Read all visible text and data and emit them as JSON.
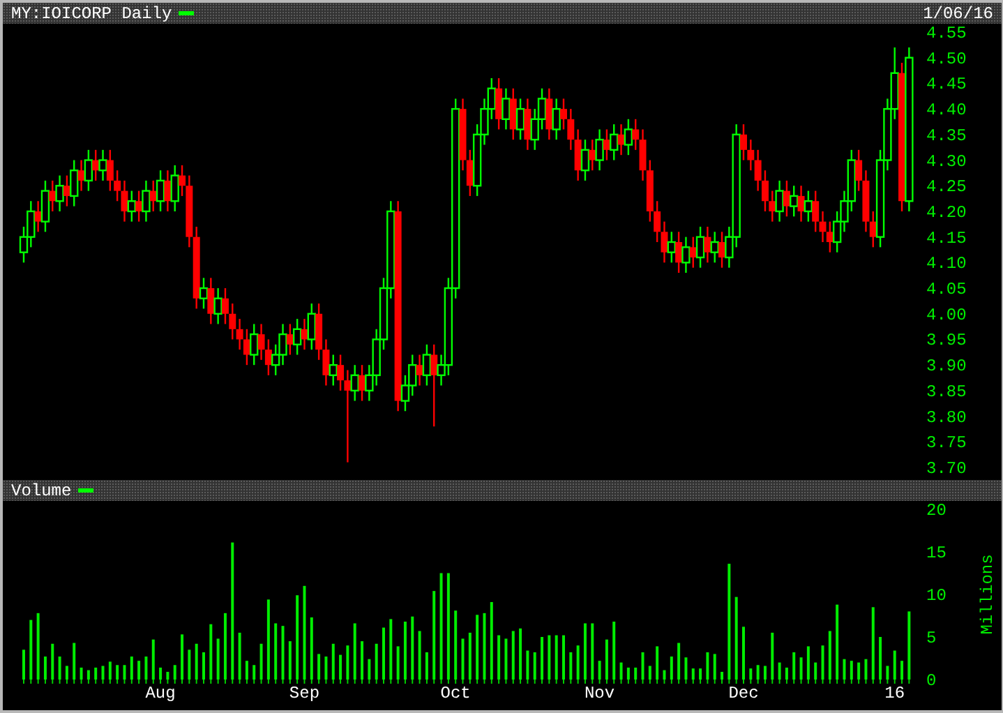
{
  "header": {
    "title": "MY:IOICORP Daily",
    "date": "1/06/16"
  },
  "price_panel": {
    "chart_data": {
      "type": "candlestick",
      "ylim": [
        3.7,
        4.55
      ],
      "yticks": [
        {
          "value": 4.55,
          "label": "4.55"
        },
        {
          "value": 4.5,
          "label": "4.50"
        },
        {
          "value": 4.45,
          "label": "4.45"
        },
        {
          "value": 4.4,
          "label": "4.40"
        },
        {
          "value": 4.35,
          "label": "4.35"
        },
        {
          "value": 4.3,
          "label": "4.30"
        },
        {
          "value": 4.25,
          "label": "4.25"
        },
        {
          "value": 4.2,
          "label": "4.20"
        },
        {
          "value": 4.15,
          "label": "4.15"
        },
        {
          "value": 4.1,
          "label": "4.10"
        },
        {
          "value": 4.05,
          "label": "4.05"
        },
        {
          "value": 4.0,
          "label": "4.00"
        },
        {
          "value": 3.95,
          "label": "3.95"
        },
        {
          "value": 3.9,
          "label": "3.90"
        },
        {
          "value": 3.85,
          "label": "3.85"
        },
        {
          "value": 3.8,
          "label": "3.80"
        },
        {
          "value": 3.75,
          "label": "3.75"
        },
        {
          "value": 3.7,
          "label": "3.70"
        }
      ],
      "ohlc": [
        [
          4.12,
          4.17,
          4.1,
          4.15
        ],
        [
          4.15,
          4.22,
          4.13,
          4.2
        ],
        [
          4.2,
          4.22,
          4.16,
          4.18
        ],
        [
          4.18,
          4.26,
          4.16,
          4.24
        ],
        [
          4.24,
          4.26,
          4.2,
          4.22
        ],
        [
          4.22,
          4.27,
          4.2,
          4.25
        ],
        [
          4.25,
          4.27,
          4.21,
          4.23
        ],
        [
          4.23,
          4.3,
          4.21,
          4.28
        ],
        [
          4.28,
          4.3,
          4.24,
          4.26
        ],
        [
          4.26,
          4.32,
          4.24,
          4.3
        ],
        [
          4.3,
          4.32,
          4.26,
          4.28
        ],
        [
          4.28,
          4.32,
          4.26,
          4.3
        ],
        [
          4.3,
          4.32,
          4.24,
          4.26
        ],
        [
          4.26,
          4.28,
          4.22,
          4.24
        ],
        [
          4.24,
          4.26,
          4.18,
          4.2
        ],
        [
          4.2,
          4.24,
          4.18,
          4.22
        ],
        [
          4.22,
          4.24,
          4.18,
          4.2
        ],
        [
          4.2,
          4.26,
          4.18,
          4.24
        ],
        [
          4.24,
          4.26,
          4.2,
          4.22
        ],
        [
          4.22,
          4.28,
          4.2,
          4.26
        ],
        [
          4.26,
          4.28,
          4.2,
          4.22
        ],
        [
          4.22,
          4.29,
          4.2,
          4.27
        ],
        [
          4.27,
          4.29,
          4.23,
          4.25
        ],
        [
          4.25,
          4.27,
          4.13,
          4.15
        ],
        [
          4.15,
          4.17,
          4.01,
          4.03
        ],
        [
          4.03,
          4.07,
          4.01,
          4.05
        ],
        [
          4.05,
          4.07,
          3.98,
          4.0
        ],
        [
          4.0,
          4.05,
          3.98,
          4.03
        ],
        [
          4.03,
          4.05,
          3.98,
          4.0
        ],
        [
          4.0,
          4.02,
          3.95,
          3.97
        ],
        [
          3.97,
          3.99,
          3.93,
          3.95
        ],
        [
          3.95,
          3.97,
          3.9,
          3.92
        ],
        [
          3.92,
          3.98,
          3.9,
          3.96
        ],
        [
          3.96,
          3.98,
          3.91,
          3.93
        ],
        [
          3.93,
          3.95,
          3.88,
          3.9
        ],
        [
          3.9,
          3.94,
          3.88,
          3.92
        ],
        [
          3.92,
          3.98,
          3.9,
          3.96
        ],
        [
          3.96,
          3.98,
          3.92,
          3.94
        ],
        [
          3.94,
          3.99,
          3.92,
          3.97
        ],
        [
          3.97,
          3.99,
          3.93,
          3.95
        ],
        [
          3.95,
          4.02,
          3.93,
          4.0
        ],
        [
          4.0,
          4.02,
          3.91,
          3.93
        ],
        [
          3.93,
          3.95,
          3.86,
          3.88
        ],
        [
          3.88,
          3.92,
          3.86,
          3.9
        ],
        [
          3.9,
          3.92,
          3.85,
          3.87
        ],
        [
          3.87,
          3.89,
          3.71,
          3.85
        ],
        [
          3.85,
          3.9,
          3.83,
          3.88
        ],
        [
          3.88,
          3.9,
          3.83,
          3.85
        ],
        [
          3.85,
          3.9,
          3.83,
          3.88
        ],
        [
          3.88,
          3.97,
          3.86,
          3.95
        ],
        [
          3.95,
          4.07,
          3.93,
          4.05
        ],
        [
          4.05,
          4.22,
          4.03,
          4.2
        ],
        [
          4.2,
          4.22,
          3.81,
          3.83
        ],
        [
          3.83,
          3.88,
          3.81,
          3.86
        ],
        [
          3.86,
          3.92,
          3.84,
          3.9
        ],
        [
          3.9,
          3.92,
          3.86,
          3.88
        ],
        [
          3.88,
          3.94,
          3.86,
          3.92
        ],
        [
          3.92,
          3.94,
          3.78,
          3.88
        ],
        [
          3.88,
          3.92,
          3.86,
          3.9
        ],
        [
          3.9,
          4.07,
          3.88,
          4.05
        ],
        [
          4.05,
          4.42,
          4.03,
          4.4
        ],
        [
          4.4,
          4.42,
          4.28,
          4.3
        ],
        [
          4.3,
          4.32,
          4.23,
          4.25
        ],
        [
          4.25,
          4.37,
          4.23,
          4.35
        ],
        [
          4.35,
          4.42,
          4.33,
          4.4
        ],
        [
          4.4,
          4.46,
          4.38,
          4.44
        ],
        [
          4.44,
          4.46,
          4.36,
          4.38
        ],
        [
          4.38,
          4.44,
          4.36,
          4.42
        ],
        [
          4.42,
          4.44,
          4.34,
          4.36
        ],
        [
          4.36,
          4.42,
          4.34,
          4.4
        ],
        [
          4.4,
          4.42,
          4.32,
          4.34
        ],
        [
          4.34,
          4.4,
          4.32,
          4.38
        ],
        [
          4.38,
          4.44,
          4.36,
          4.42
        ],
        [
          4.42,
          4.44,
          4.34,
          4.36
        ],
        [
          4.36,
          4.42,
          4.34,
          4.4
        ],
        [
          4.4,
          4.42,
          4.36,
          4.38
        ],
        [
          4.38,
          4.4,
          4.32,
          4.34
        ],
        [
          4.34,
          4.36,
          4.26,
          4.28
        ],
        [
          4.28,
          4.34,
          4.26,
          4.32
        ],
        [
          4.32,
          4.34,
          4.28,
          4.3
        ],
        [
          4.3,
          4.36,
          4.28,
          4.34
        ],
        [
          4.34,
          4.36,
          4.3,
          4.32
        ],
        [
          4.32,
          4.37,
          4.3,
          4.35
        ],
        [
          4.35,
          4.37,
          4.31,
          4.33
        ],
        [
          4.33,
          4.38,
          4.31,
          4.36
        ],
        [
          4.36,
          4.38,
          4.32,
          4.34
        ],
        [
          4.34,
          4.36,
          4.26,
          4.28
        ],
        [
          4.28,
          4.3,
          4.18,
          4.2
        ],
        [
          4.2,
          4.22,
          4.14,
          4.16
        ],
        [
          4.16,
          4.18,
          4.1,
          4.12
        ],
        [
          4.12,
          4.16,
          4.1,
          4.14
        ],
        [
          4.14,
          4.16,
          4.08,
          4.1
        ],
        [
          4.1,
          4.15,
          4.08,
          4.13
        ],
        [
          4.13,
          4.15,
          4.09,
          4.11
        ],
        [
          4.11,
          4.17,
          4.09,
          4.15
        ],
        [
          4.15,
          4.17,
          4.1,
          4.12
        ],
        [
          4.12,
          4.16,
          4.1,
          4.14
        ],
        [
          4.14,
          4.16,
          4.09,
          4.11
        ],
        [
          4.11,
          4.17,
          4.09,
          4.15
        ],
        [
          4.15,
          4.37,
          4.13,
          4.35
        ],
        [
          4.35,
          4.37,
          4.3,
          4.32
        ],
        [
          4.32,
          4.34,
          4.28,
          4.3
        ],
        [
          4.3,
          4.32,
          4.24,
          4.26
        ],
        [
          4.26,
          4.28,
          4.2,
          4.22
        ],
        [
          4.22,
          4.24,
          4.18,
          4.2
        ],
        [
          4.2,
          4.26,
          4.18,
          4.24
        ],
        [
          4.24,
          4.26,
          4.19,
          4.21
        ],
        [
          4.21,
          4.25,
          4.19,
          4.23
        ],
        [
          4.23,
          4.25,
          4.18,
          4.2
        ],
        [
          4.2,
          4.24,
          4.18,
          4.22
        ],
        [
          4.22,
          4.24,
          4.16,
          4.18
        ],
        [
          4.18,
          4.2,
          4.14,
          4.16
        ],
        [
          4.16,
          4.18,
          4.12,
          4.14
        ],
        [
          4.14,
          4.2,
          4.12,
          4.18
        ],
        [
          4.18,
          4.24,
          4.16,
          4.22
        ],
        [
          4.22,
          4.32,
          4.2,
          4.3
        ],
        [
          4.3,
          4.32,
          4.24,
          4.26
        ],
        [
          4.26,
          4.28,
          4.16,
          4.18
        ],
        [
          4.18,
          4.2,
          4.13,
          4.15
        ],
        [
          4.15,
          4.32,
          4.13,
          4.3
        ],
        [
          4.3,
          4.42,
          4.28,
          4.4
        ],
        [
          4.4,
          4.52,
          4.38,
          4.47
        ],
        [
          4.47,
          4.49,
          4.2,
          4.22
        ],
        [
          4.22,
          4.52,
          4.2,
          4.5
        ]
      ]
    }
  },
  "volume_panel": {
    "title": "Volume",
    "chart_data": {
      "type": "bar",
      "ylabel": "Millions",
      "ylim": [
        0,
        20
      ],
      "yticks": [
        {
          "value": 0,
          "label": "0"
        },
        {
          "value": 5,
          "label": "5"
        },
        {
          "value": 10,
          "label": "10"
        },
        {
          "value": 15,
          "label": "15"
        },
        {
          "value": 20,
          "label": "20"
        }
      ],
      "categories": [
        null,
        null,
        null,
        null,
        null,
        null,
        null,
        null,
        null,
        null,
        null,
        null,
        null,
        null,
        null,
        null,
        null,
        null,
        null,
        "Aug",
        null,
        null,
        null,
        null,
        null,
        null,
        null,
        null,
        null,
        null,
        null,
        null,
        null,
        null,
        null,
        null,
        null,
        null,
        null,
        "Sep",
        null,
        null,
        null,
        null,
        null,
        null,
        null,
        null,
        null,
        null,
        null,
        null,
        null,
        null,
        null,
        null,
        null,
        null,
        null,
        null,
        "Oct",
        null,
        null,
        null,
        null,
        null,
        null,
        null,
        null,
        null,
        null,
        null,
        null,
        null,
        null,
        null,
        null,
        null,
        null,
        null,
        "Nov",
        null,
        null,
        null,
        null,
        null,
        null,
        null,
        null,
        null,
        null,
        null,
        null,
        null,
        null,
        null,
        null,
        null,
        null,
        null,
        "Dec",
        null,
        null,
        null,
        null,
        null,
        null,
        null,
        null,
        null,
        null,
        null,
        null,
        null,
        null,
        null,
        null,
        null,
        null,
        null,
        null,
        "16",
        null,
        null
      ],
      "values": [
        3.5,
        7.0,
        7.8,
        2.7,
        4.2,
        2.7,
        1.6,
        4.3,
        1.4,
        1.1,
        1.4,
        1.6,
        2.1,
        1.7,
        1.7,
        2.7,
        2.2,
        2.7,
        4.7,
        1.4,
        0.9,
        1.7,
        5.3,
        3.5,
        4.2,
        3.2,
        6.5,
        4.8,
        7.8,
        16.1,
        5.5,
        2.2,
        1.7,
        4.2,
        9.4,
        6.6,
        6.3,
        4.5,
        9.9,
        11.0,
        7.3,
        3.0,
        2.7,
        4.2,
        2.9,
        4.0,
        6.6,
        4.5,
        2.4,
        4.2,
        6.1,
        7.1,
        3.9,
        6.8,
        7.4,
        5.7,
        3.2,
        10.4,
        12.5,
        12.5,
        8.1,
        4.8,
        5.5,
        7.6,
        7.8,
        9.1,
        5.2,
        4.8,
        5.7,
        6.0,
        3.4,
        3.2,
        5.0,
        5.2,
        5.2,
        5.2,
        3.2,
        4.0,
        6.6,
        6.6,
        2.2,
        4.7,
        6.8,
        2.0,
        1.4,
        1.4,
        3.2,
        1.6,
        3.9,
        1.1,
        2.7,
        4.3,
        2.6,
        1.3,
        1.3,
        3.2,
        3.0,
        0.9,
        13.6,
        9.7,
        6.2,
        1.3,
        1.7,
        1.6,
        5.5,
        2.0,
        1.4,
        3.2,
        2.6,
        3.9,
        2.0,
        4.0,
        5.7,
        8.8,
        2.4,
        2.2,
        2.0,
        2.4,
        8.5,
        5.0,
        1.6,
        3.4,
        2.2,
        8.0
      ]
    }
  }
}
